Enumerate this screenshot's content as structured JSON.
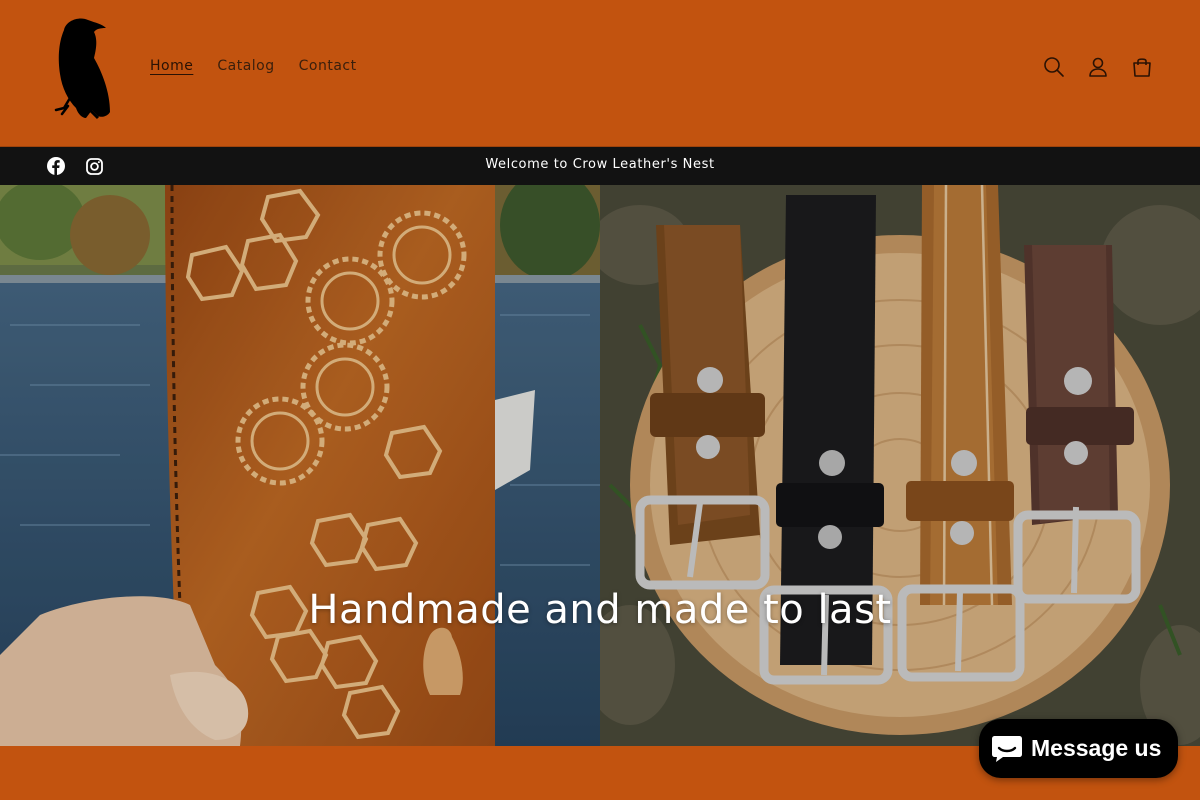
{
  "header": {
    "logo_icon": "crow-logo-icon",
    "nav": [
      {
        "label": "Home",
        "active": true
      },
      {
        "label": "Catalog",
        "active": false
      },
      {
        "label": "Contact",
        "active": false
      }
    ],
    "icons": [
      "search-icon",
      "account-icon",
      "cart-icon"
    ]
  },
  "announcement": {
    "text": "Welcome to Crow Leather's Nest",
    "social_icons": [
      "facebook-icon",
      "instagram-icon"
    ]
  },
  "hero": {
    "heading": "Handmade and made to last",
    "left_image": "tooled-leather-wallet-with-gears-photo",
    "right_image": "four-leather-belts-on-tree-stump-photo"
  },
  "chat": {
    "label": "Message us",
    "icon": "chat-bubble-icon"
  },
  "colors": {
    "brand": "#c2530f",
    "announcement_bg": "#121212",
    "chat_bg": "#000000"
  }
}
